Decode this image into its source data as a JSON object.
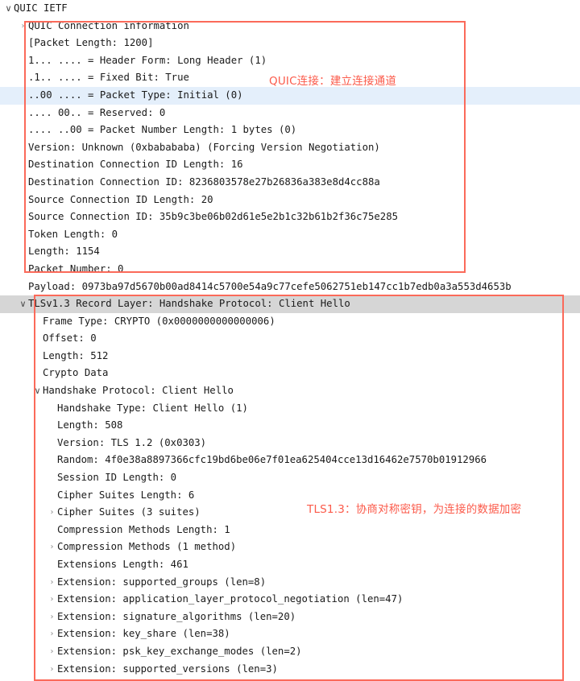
{
  "app": {
    "pane": "packet-details",
    "colors": {
      "annotation_red": "#fb5a4a",
      "box_red": "#fb6a5a",
      "selected_blue": "#e4effb",
      "selected_gray": "#d6d6d6",
      "text": "#1a1a1a",
      "twisty": "#8a8a8a",
      "background": "#ffffff"
    }
  },
  "icons": {
    "collapsed": "›",
    "expanded": "∨"
  },
  "annotations": [
    {
      "id": "quic",
      "text": "QUIC连接：建立连接通道",
      "color": "#fb5a4a"
    },
    {
      "id": "tls",
      "text": "TLS1.3：协商对称密钥，为连接的数据加密",
      "color": "#fb5a4a"
    }
  ],
  "tree": [
    {
      "indent": 0,
      "twisty": "expanded",
      "text": "QUIC IETF",
      "selected": "none"
    },
    {
      "indent": 1,
      "twisty": "collapsed",
      "text": "QUIC Connection information",
      "selected": "none"
    },
    {
      "indent": 1,
      "twisty": "none",
      "text": "[Packet Length: 1200]",
      "selected": "none"
    },
    {
      "indent": 1,
      "twisty": "none",
      "text": "1... .... = Header Form: Long Header (1)",
      "selected": "none"
    },
    {
      "indent": 1,
      "twisty": "none",
      "text": ".1.. .... = Fixed Bit: True",
      "selected": "none"
    },
    {
      "indent": 1,
      "twisty": "none",
      "text": "..00 .... = Packet Type: Initial (0)",
      "selected": "blue"
    },
    {
      "indent": 1,
      "twisty": "none",
      "text": ".... 00.. = Reserved: 0",
      "selected": "none"
    },
    {
      "indent": 1,
      "twisty": "none",
      "text": ".... ..00 = Packet Number Length: 1 bytes (0)",
      "selected": "none"
    },
    {
      "indent": 1,
      "twisty": "none",
      "text": "Version: Unknown (0xbabababa) (Forcing Version Negotiation)",
      "selected": "none"
    },
    {
      "indent": 1,
      "twisty": "none",
      "text": "Destination Connection ID Length: 16",
      "selected": "none"
    },
    {
      "indent": 1,
      "twisty": "none",
      "text": "Destination Connection ID: 8236803578e27b26836a383e8d4cc88a",
      "selected": "none"
    },
    {
      "indent": 1,
      "twisty": "none",
      "text": "Source Connection ID Length: 20",
      "selected": "none"
    },
    {
      "indent": 1,
      "twisty": "none",
      "text": "Source Connection ID: 35b9c3be06b02d61e5e2b1c32b61b2f36c75e285",
      "selected": "none"
    },
    {
      "indent": 1,
      "twisty": "none",
      "text": "Token Length: 0",
      "selected": "none"
    },
    {
      "indent": 1,
      "twisty": "none",
      "text": "Length: 1154",
      "selected": "none"
    },
    {
      "indent": 1,
      "twisty": "none",
      "text": "Packet Number: 0",
      "selected": "none"
    },
    {
      "indent": 1,
      "twisty": "none",
      "text": "Payload: 0973ba97d5670b00ad8414c5700e54a9c77cefe5062751eb147cc1b7edb0a3a553d4653b",
      "selected": "none"
    },
    {
      "indent": 1,
      "twisty": "expanded",
      "text": "TLSv1.3 Record Layer: Handshake Protocol: Client Hello",
      "selected": "gray"
    },
    {
      "indent": 2,
      "twisty": "none",
      "text": "Frame Type: CRYPTO (0x0000000000000006)",
      "selected": "none"
    },
    {
      "indent": 2,
      "twisty": "none",
      "text": "Offset: 0",
      "selected": "none"
    },
    {
      "indent": 2,
      "twisty": "none",
      "text": "Length: 512",
      "selected": "none"
    },
    {
      "indent": 2,
      "twisty": "none",
      "text": "Crypto Data",
      "selected": "none"
    },
    {
      "indent": 2,
      "twisty": "expanded",
      "text": "Handshake Protocol: Client Hello",
      "selected": "none"
    },
    {
      "indent": 3,
      "twisty": "none",
      "text": "Handshake Type: Client Hello (1)",
      "selected": "none"
    },
    {
      "indent": 3,
      "twisty": "none",
      "text": "Length: 508",
      "selected": "none"
    },
    {
      "indent": 3,
      "twisty": "none",
      "text": "Version: TLS 1.2 (0x0303)",
      "selected": "none"
    },
    {
      "indent": 3,
      "twisty": "none",
      "text": "Random: 4f0e38a8897366cfc19bd6be06e7f01ea625404cce13d16462e7570b01912966",
      "selected": "none"
    },
    {
      "indent": 3,
      "twisty": "none",
      "text": "Session ID Length: 0",
      "selected": "none"
    },
    {
      "indent": 3,
      "twisty": "none",
      "text": "Cipher Suites Length: 6",
      "selected": "none"
    },
    {
      "indent": 3,
      "twisty": "collapsed",
      "text": "Cipher Suites (3 suites)",
      "selected": "none"
    },
    {
      "indent": 3,
      "twisty": "none",
      "text": "Compression Methods Length: 1",
      "selected": "none"
    },
    {
      "indent": 3,
      "twisty": "collapsed",
      "text": "Compression Methods (1 method)",
      "selected": "none"
    },
    {
      "indent": 3,
      "twisty": "none",
      "text": "Extensions Length: 461",
      "selected": "none"
    },
    {
      "indent": 3,
      "twisty": "collapsed",
      "text": "Extension: supported_groups (len=8)",
      "selected": "none"
    },
    {
      "indent": 3,
      "twisty": "collapsed",
      "text": "Extension: application_layer_protocol_negotiation (len=47)",
      "selected": "none"
    },
    {
      "indent": 3,
      "twisty": "collapsed",
      "text": "Extension: signature_algorithms (len=20)",
      "selected": "none"
    },
    {
      "indent": 3,
      "twisty": "collapsed",
      "text": "Extension: key_share (len=38)",
      "selected": "none"
    },
    {
      "indent": 3,
      "twisty": "collapsed",
      "text": "Extension: psk_key_exchange_modes (len=2)",
      "selected": "none"
    },
    {
      "indent": 3,
      "twisty": "collapsed",
      "text": "Extension: supported_versions (len=3)",
      "selected": "none"
    }
  ]
}
